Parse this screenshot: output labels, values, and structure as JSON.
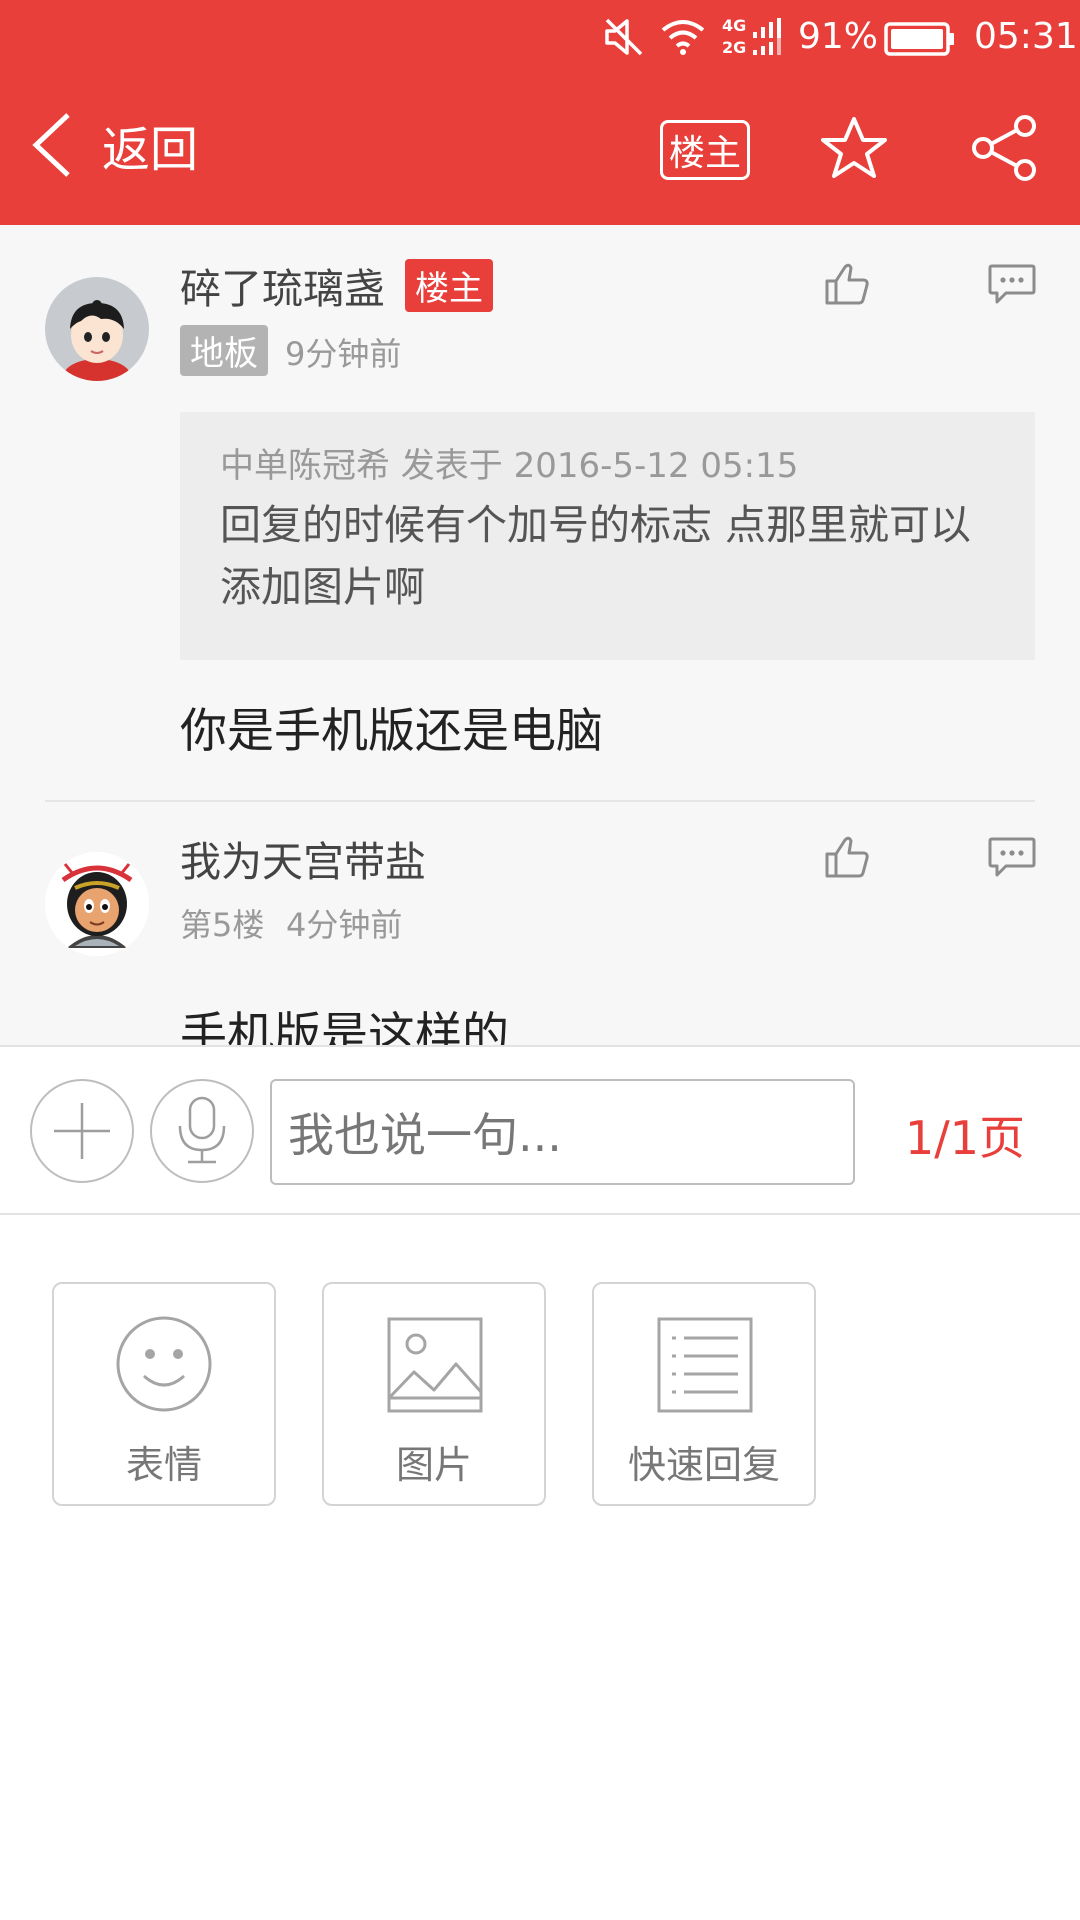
{
  "status_bar": {
    "network_4g": "4G",
    "network_2g": "2G",
    "battery": "91%",
    "time": "05:31"
  },
  "nav": {
    "back_label": "返回",
    "owner_button": "楼主"
  },
  "posts": [
    {
      "username": "碎了琉璃盏",
      "owner_badge": "楼主",
      "floor": "地板",
      "time": "9分钟前",
      "quote": {
        "meta": "中单陈冠希 发表于 2016-5-12 05:15",
        "body_line1": "回复的时候有个加号的标志 点那里就可以",
        "body_line2": "添加图片啊"
      },
      "text": "你是手机版还是电脑"
    },
    {
      "username": "我为天宫带盐",
      "floor": "第5楼",
      "time": "4分钟前",
      "text": "手机版是这样的"
    }
  ],
  "reply_bar": {
    "placeholder": "我也说一句...",
    "page_indicator": "1/1页"
  },
  "tools": [
    {
      "label": "表情",
      "icon": "smiley-icon"
    },
    {
      "label": "图片",
      "icon": "image-icon"
    },
    {
      "label": "快速回复",
      "icon": "quick-reply-icon"
    }
  ],
  "colors": {
    "brand_red": "#E83F3B"
  }
}
